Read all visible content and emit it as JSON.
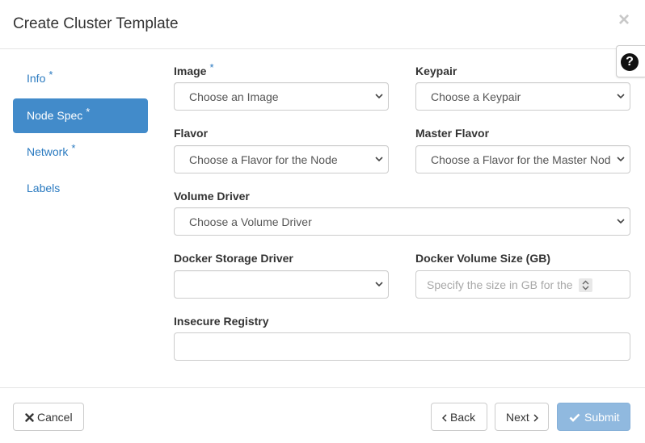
{
  "dialog": {
    "title": "Create Cluster Template",
    "close_symbol": "×",
    "help_symbol": "?"
  },
  "sidebar": {
    "items": [
      {
        "label": "Info",
        "required": "*",
        "active": false
      },
      {
        "label": "Node Spec",
        "required": "*",
        "active": true
      },
      {
        "label": "Network",
        "required": "*",
        "active": false
      },
      {
        "label": "Labels",
        "required": "",
        "active": false
      }
    ]
  },
  "form": {
    "image": {
      "label": "Image",
      "required": "*",
      "value": "Choose an Image"
    },
    "keypair": {
      "label": "Keypair",
      "value": "Choose a Keypair"
    },
    "flavor": {
      "label": "Flavor",
      "value": "Choose a Flavor for the Node"
    },
    "master_flavor": {
      "label": "Master Flavor",
      "value": "Choose a Flavor for the Master Nod"
    },
    "volume_driver": {
      "label": "Volume Driver",
      "value": "Choose a Volume Driver"
    },
    "docker_storage_driver": {
      "label": "Docker Storage Driver",
      "value": ""
    },
    "docker_volume_size": {
      "label": "Docker Volume Size (GB)",
      "placeholder": "Specify the size in GB for the"
    },
    "insecure_registry": {
      "label": "Insecure Registry",
      "value": ""
    }
  },
  "footer": {
    "cancel": "Cancel",
    "back": "Back",
    "next": "Next",
    "submit": "Submit"
  },
  "colors": {
    "accent": "#428bca",
    "link": "#2a7ac0",
    "submit_disabled": "#90b9df"
  }
}
